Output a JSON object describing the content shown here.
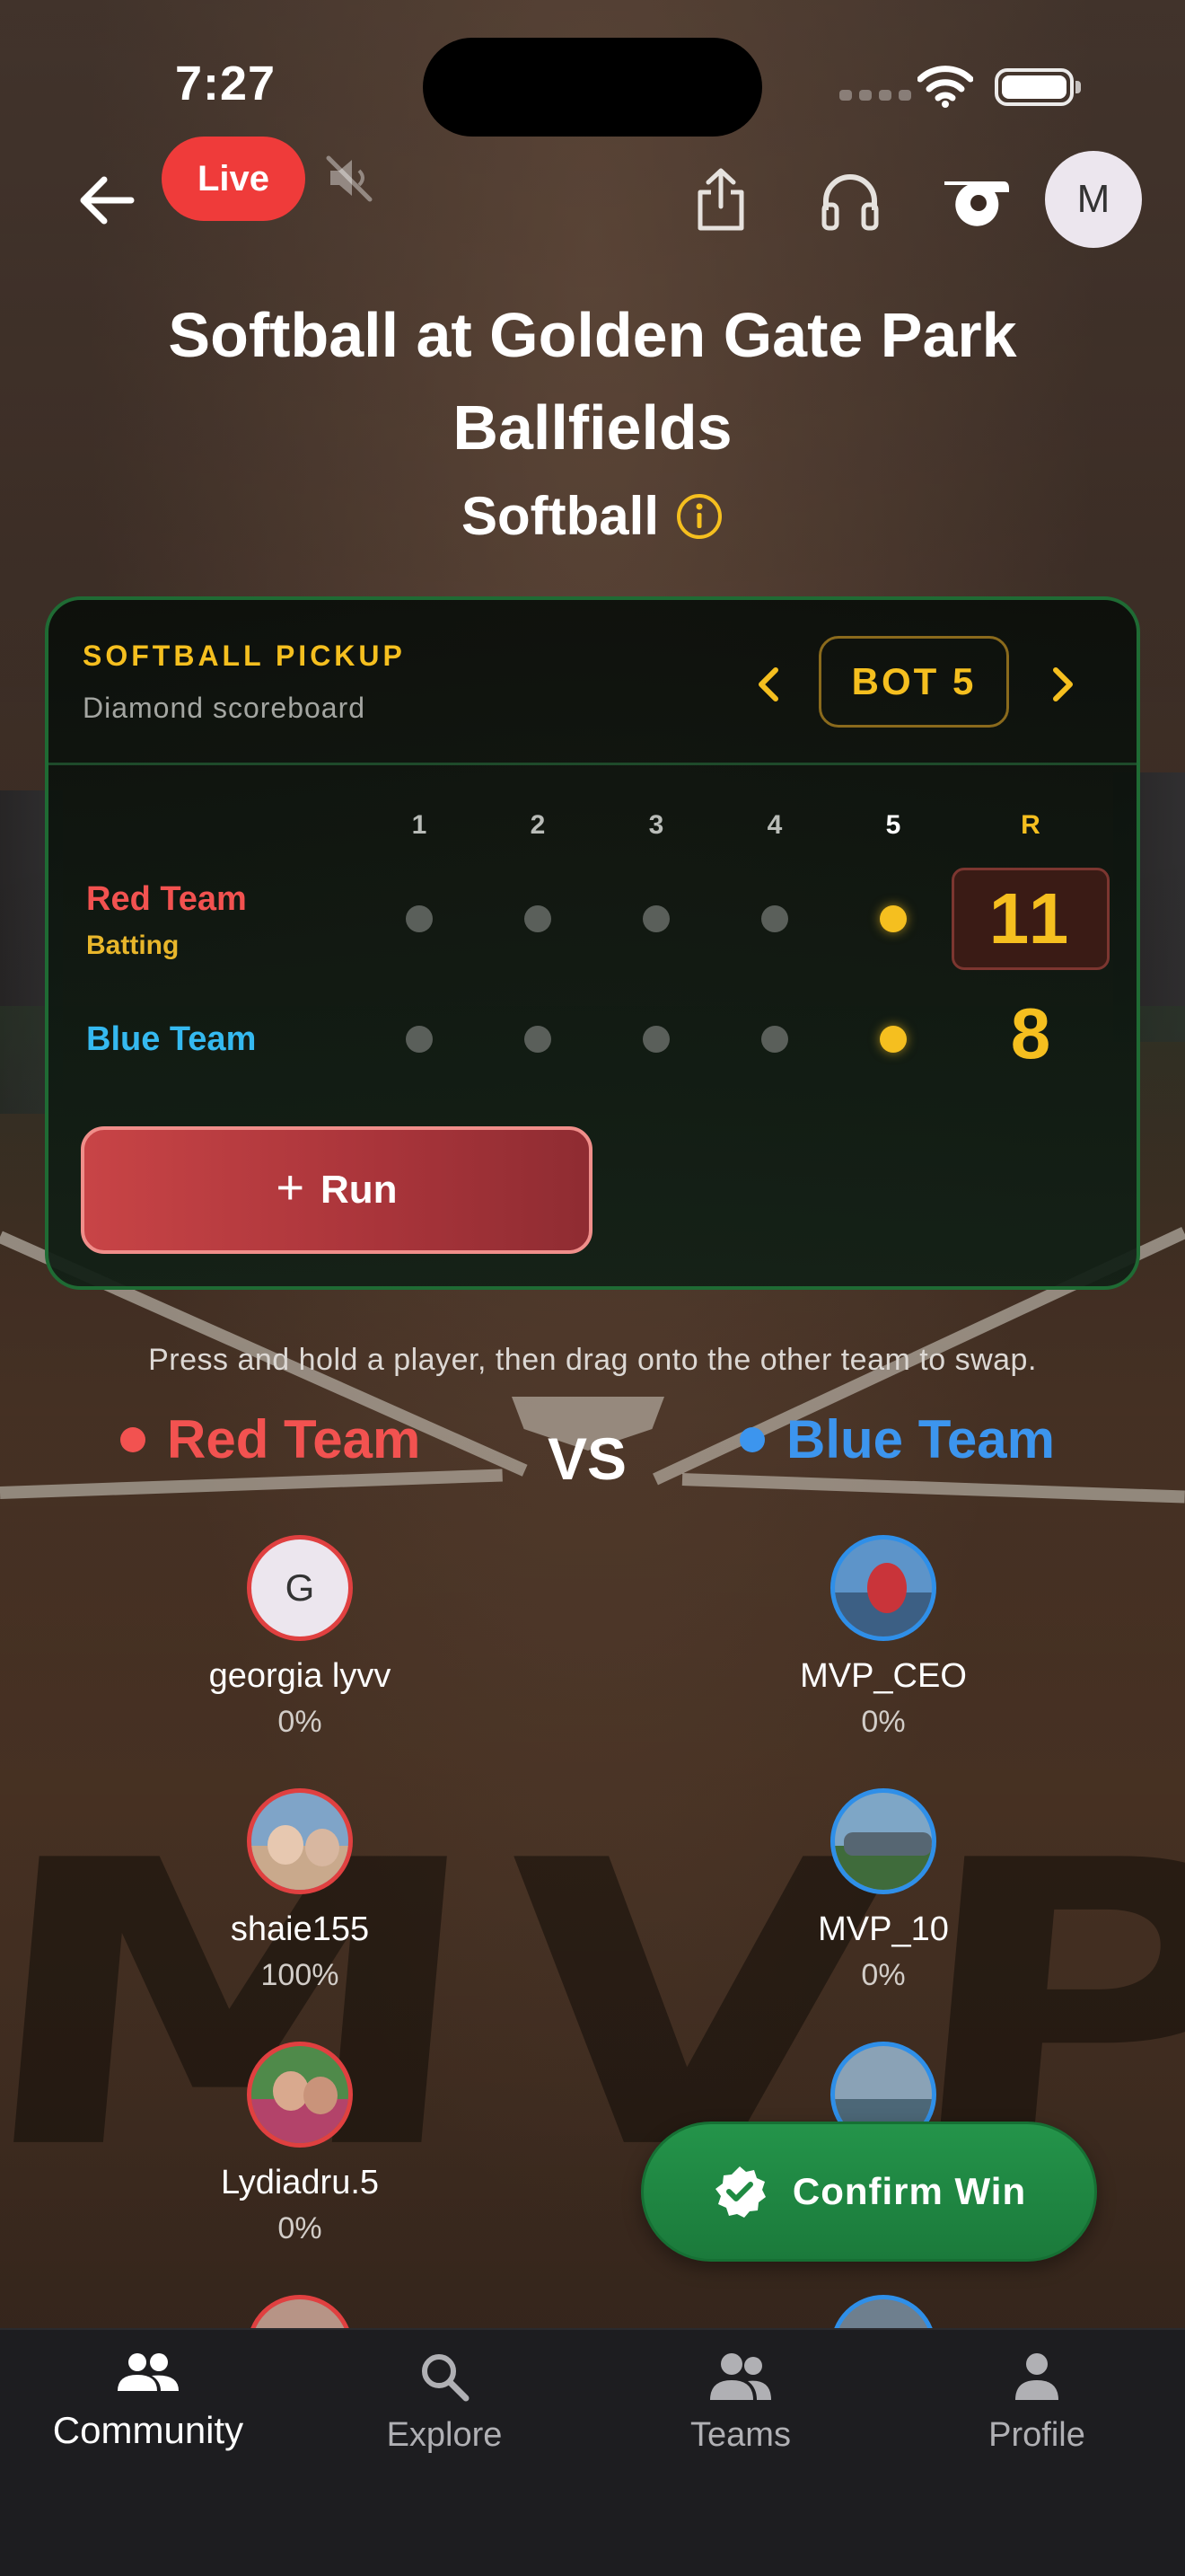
{
  "status_bar": {
    "time": "7:27"
  },
  "header": {
    "live_label": "Live",
    "avatar_initial": "M"
  },
  "event": {
    "title": "Softball at Golden Gate Park Ballfields",
    "sport": "Softball"
  },
  "scoreboard": {
    "title": "SOFTBALL PICKUP",
    "subtitle": "Diamond scoreboard",
    "inning": "BOT 5",
    "columns": [
      "1",
      "2",
      "3",
      "4",
      "5",
      "R"
    ],
    "current_inning": 5,
    "teams": [
      {
        "name": "Red Team",
        "status": "Batting",
        "runs": "11"
      },
      {
        "name": "Blue Team",
        "status": "",
        "runs": "8"
      }
    ],
    "run_button": "Run"
  },
  "teams_section": {
    "hint": "Press and hold a player, then drag onto the other team to swap.",
    "vs": "VS",
    "red_team": "Red Team",
    "blue_team": "Blue Team",
    "red_players": [
      {
        "name": "georgia lyvv",
        "pct": "0%",
        "initial": "G"
      },
      {
        "name": "shaie155",
        "pct": "100%"
      },
      {
        "name": "Lydiadru.5",
        "pct": "0%"
      }
    ],
    "blue_players": [
      {
        "name": "MVP_CEO",
        "pct": "0%"
      },
      {
        "name": "MVP_10",
        "pct": "0%"
      }
    ]
  },
  "confirm_button": "Confirm Win",
  "tabs": [
    {
      "label": "Community",
      "icon": "community-icon"
    },
    {
      "label": "Explore",
      "icon": "search-icon"
    },
    {
      "label": "Teams",
      "icon": "teams-icon"
    },
    {
      "label": "Profile",
      "icon": "profile-icon"
    }
  ],
  "colors": {
    "live": "#ef3b3a",
    "red_team": "#f25250",
    "blue_team": "#35b9f0",
    "accent": "#f5bf1f",
    "confirm": "#1f8a42"
  }
}
